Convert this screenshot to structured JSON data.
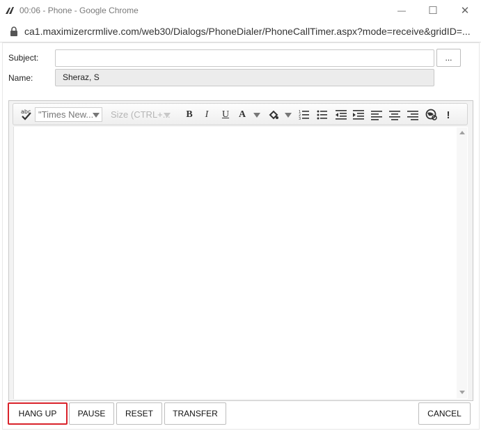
{
  "window": {
    "title": "00:06 - Phone - Google Chrome",
    "minimize_glyph": "—",
    "maximize_glyph": "☐",
    "close_glyph": "✕"
  },
  "address_bar": {
    "url": "ca1.maximizercrmlive.com/web30/Dialogs/PhoneDialer/PhoneCallTimer.aspx?mode=receive&gridID=..."
  },
  "form": {
    "subject_label": "Subject:",
    "subject_value": "",
    "lookup_button_label": "...",
    "name_label": "Name:",
    "name_value": "Sheraz, S"
  },
  "toolbar": {
    "spellcheck_label": "abc",
    "font_family_value": "\"Times New...",
    "font_size_placeholder": "Size (CTRL+...",
    "bold_label": "B",
    "italic_label": "I",
    "underline_label": "U",
    "font_color_label": "A",
    "important_label": "!"
  },
  "buttons": {
    "hang_up": "HANG UP",
    "pause": "PAUSE",
    "reset": "RESET",
    "transfer": "TRANSFER",
    "cancel": "CANCEL"
  },
  "colors": {
    "highlight_border": "#d9222a"
  }
}
